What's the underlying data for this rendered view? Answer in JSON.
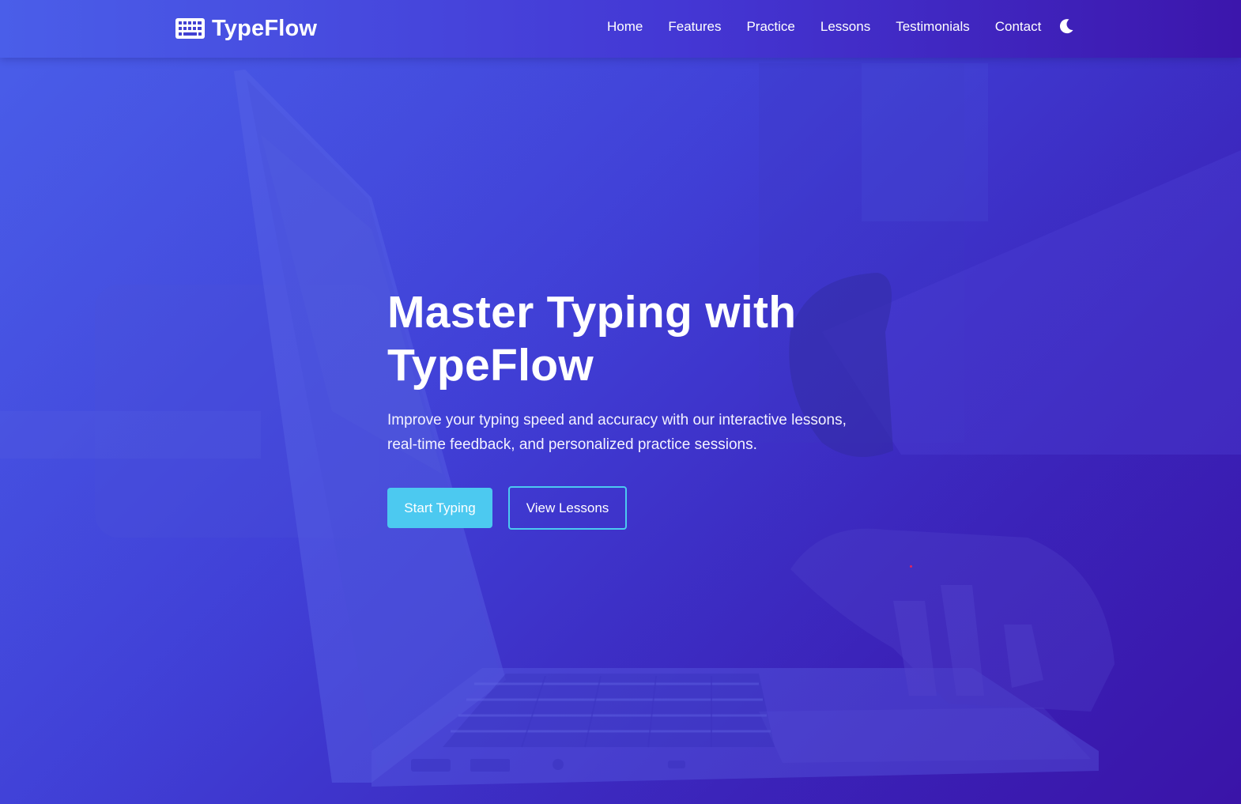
{
  "brand": {
    "name": "TypeFlow",
    "icon": "keyboard-icon"
  },
  "nav": {
    "items": [
      {
        "label": "Home"
      },
      {
        "label": "Features"
      },
      {
        "label": "Practice"
      },
      {
        "label": "Lessons"
      },
      {
        "label": "Testimonials"
      },
      {
        "label": "Contact"
      }
    ],
    "theme_toggle_icon": "moon-icon"
  },
  "hero": {
    "title_line1": "Master Typing with",
    "title_line2": "TypeFlow",
    "subtitle_line1": "Improve your typing speed and accuracy with our interactive lessons,",
    "subtitle_line2": "real-time feedback, and personalized practice sessions.",
    "primary_button": "Start Typing",
    "secondary_button": "View Lessons"
  },
  "colors": {
    "gradient_start": "#4a5ee9",
    "gradient_mid": "#4040d6",
    "gradient_end": "#3a14a8",
    "accent": "#4cc9f0",
    "text": "#ffffff"
  }
}
